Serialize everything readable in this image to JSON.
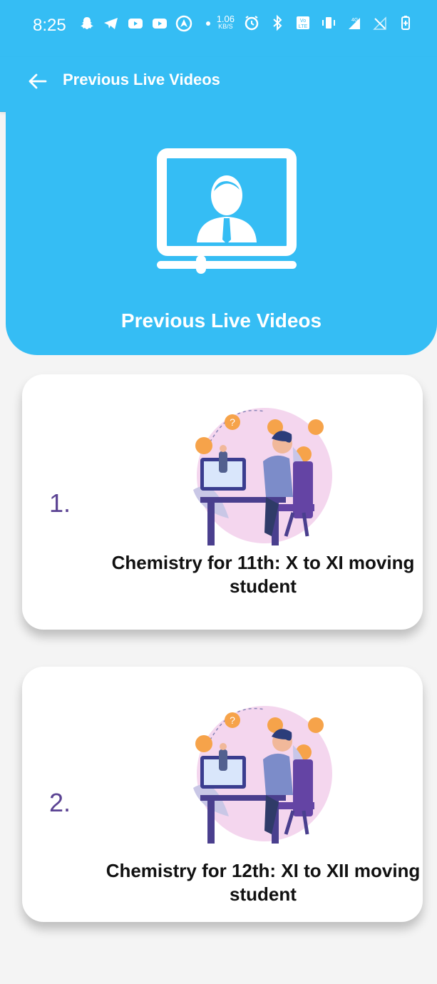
{
  "status_bar": {
    "time": "8:25",
    "speed_value": "1.06",
    "speed_unit": "KB/S",
    "icons_left": [
      "snapchat-icon",
      "telegram-icon",
      "youtube-icon",
      "youtube-icon",
      "maps-icon",
      "dot-icon"
    ],
    "icons_right": [
      "alarm-icon",
      "bluetooth-icon",
      "volte-icon",
      "vibrate-icon",
      "signal-4g-icon",
      "no-signal-icon",
      "battery-icon"
    ]
  },
  "app_bar": {
    "title": "Previous Live Videos"
  },
  "hero": {
    "title": "Previous Live Videos"
  },
  "videos": [
    {
      "number": "1.",
      "title": "Chemistry for 11th: X to XI moving student"
    },
    {
      "number": "2.",
      "title": "Chemistry for 12th: XI to XII moving student"
    }
  ],
  "colors": {
    "primary": "#35bdf4",
    "accent_number": "#5b4393",
    "background": "#f4f4f4",
    "card": "#ffffff"
  }
}
